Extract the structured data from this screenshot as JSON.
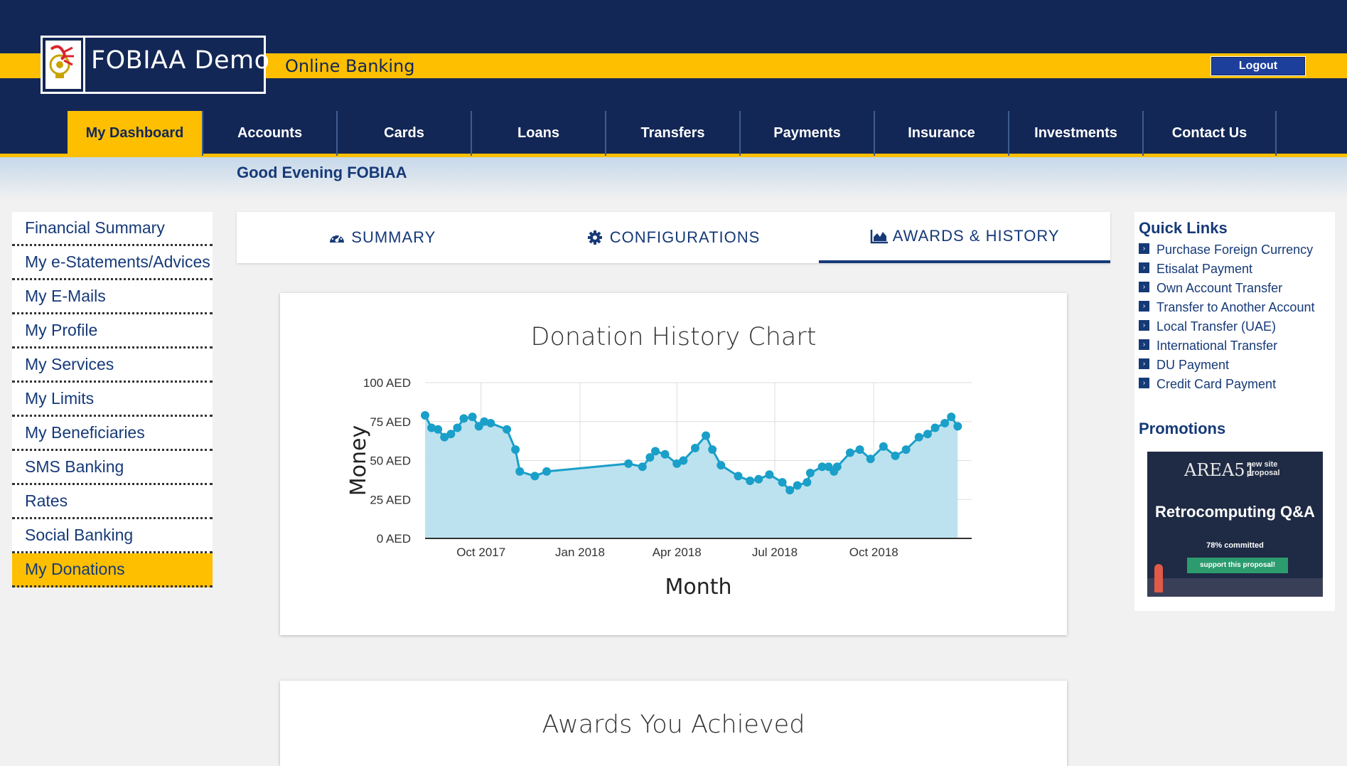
{
  "header": {
    "logo_text": "FOBIAA Demo",
    "subtitle": "Online Banking",
    "logout_label": "Logout",
    "greeting": "Good Evening FOBIAA"
  },
  "nav": [
    {
      "label": "My Dashboard",
      "active": true
    },
    {
      "label": "Accounts"
    },
    {
      "label": "Cards"
    },
    {
      "label": "Loans"
    },
    {
      "label": "Transfers"
    },
    {
      "label": "Payments"
    },
    {
      "label": "Insurance"
    },
    {
      "label": "Investments"
    },
    {
      "label": "Contact Us"
    }
  ],
  "sidebar": [
    {
      "label": "Financial Summary"
    },
    {
      "label": "My e-Statements/Advices"
    },
    {
      "label": "My E-Mails"
    },
    {
      "label": "My Profile"
    },
    {
      "label": "My Services"
    },
    {
      "label": "My Limits"
    },
    {
      "label": "My Beneficiaries"
    },
    {
      "label": "SMS Banking"
    },
    {
      "label": "Rates"
    },
    {
      "label": "Social Banking"
    },
    {
      "label": "My Donations",
      "active": true
    }
  ],
  "tabs": [
    {
      "label": "SUMMARY",
      "icon": "dashboard-icon"
    },
    {
      "label": "CONFIGURATIONS",
      "icon": "gear-icon"
    },
    {
      "label": "AWARDS & HISTORY",
      "icon": "area-chart-icon",
      "active": true
    }
  ],
  "awards": {
    "title": "Awards You Achieved"
  },
  "quick_links": {
    "title": "Quick Links",
    "items": [
      "Purchase Foreign Currency",
      "Etisalat Payment",
      "Own Account Transfer",
      "Transfer to Another Account",
      "Local Transfer (UAE)",
      "International Transfer",
      "DU Payment",
      "Credit Card Payment"
    ]
  },
  "promotions": {
    "title": "Promotions",
    "brand": "AREA51",
    "badge": "new site proposal",
    "headline": "Retrocomputing Q&A",
    "committed": "78% committed",
    "button": "support this proposal!"
  },
  "colors": {
    "navy": "#132756",
    "gold": "#fdbf00",
    "series": "#1a9fc9",
    "fill": "#b8e0ee"
  },
  "chart_data": {
    "type": "area",
    "title": "Donation History Chart",
    "xlabel": "Month",
    "ylabel": "Money",
    "ylim": [
      0,
      100
    ],
    "yticks": [
      "0 AED",
      "25 AED",
      "50 AED",
      "75 AED",
      "100 AED"
    ],
    "xticks": [
      {
        "date": "2017-10-01",
        "label": "Oct 2017"
      },
      {
        "date": "2018-01-01",
        "label": "Jan 2018"
      },
      {
        "date": "2018-04-01",
        "label": "Apr 2018"
      },
      {
        "date": "2018-07-01",
        "label": "Jul 2018"
      },
      {
        "date": "2018-10-01",
        "label": "Oct 2018"
      }
    ],
    "x_range": [
      "2017-08-10",
      "2018-12-31"
    ],
    "grid": true,
    "legend": "none",
    "series": [
      {
        "points": [
          [
            "2017-08-10",
            79
          ],
          [
            "2017-08-16",
            71
          ],
          [
            "2017-08-22",
            70
          ],
          [
            "2017-08-28",
            65
          ],
          [
            "2017-09-03",
            67
          ],
          [
            "2017-09-09",
            71
          ],
          [
            "2017-09-15",
            77
          ],
          [
            "2017-09-23",
            78
          ],
          [
            "2017-09-29",
            72
          ],
          [
            "2017-10-04",
            75
          ],
          [
            "2017-10-10",
            74
          ],
          [
            "2017-10-25",
            70
          ],
          [
            "2017-11-02",
            57
          ],
          [
            "2017-11-06",
            43
          ],
          [
            "2017-11-20",
            40
          ],
          [
            "2017-12-01",
            43
          ],
          [
            "2018-02-15",
            48
          ],
          [
            "2018-02-28",
            46
          ],
          [
            "2018-03-07",
            52
          ],
          [
            "2018-03-12",
            56
          ],
          [
            "2018-03-21",
            54
          ],
          [
            "2018-04-01",
            48
          ],
          [
            "2018-04-07",
            50
          ],
          [
            "2018-04-18",
            58
          ],
          [
            "2018-04-28",
            66
          ],
          [
            "2018-05-04",
            57
          ],
          [
            "2018-05-12",
            47
          ],
          [
            "2018-05-28",
            40
          ],
          [
            "2018-06-08",
            37
          ],
          [
            "2018-06-16",
            38
          ],
          [
            "2018-06-26",
            41
          ],
          [
            "2018-07-08",
            36
          ],
          [
            "2018-07-15",
            31
          ],
          [
            "2018-07-22",
            34
          ],
          [
            "2018-07-31",
            36
          ],
          [
            "2018-08-03",
            42
          ],
          [
            "2018-08-14",
            46
          ],
          [
            "2018-08-20",
            46
          ],
          [
            "2018-08-25",
            43
          ],
          [
            "2018-08-28",
            46
          ],
          [
            "2018-09-09",
            55
          ],
          [
            "2018-09-18",
            57
          ],
          [
            "2018-09-28",
            51
          ],
          [
            "2018-10-10",
            59
          ],
          [
            "2018-10-21",
            53
          ],
          [
            "2018-10-31",
            57
          ],
          [
            "2018-11-12",
            65
          ],
          [
            "2018-11-20",
            67
          ],
          [
            "2018-11-27",
            71
          ],
          [
            "2018-12-06",
            74
          ],
          [
            "2018-12-12",
            78
          ],
          [
            "2018-12-18",
            72
          ]
        ]
      }
    ]
  }
}
